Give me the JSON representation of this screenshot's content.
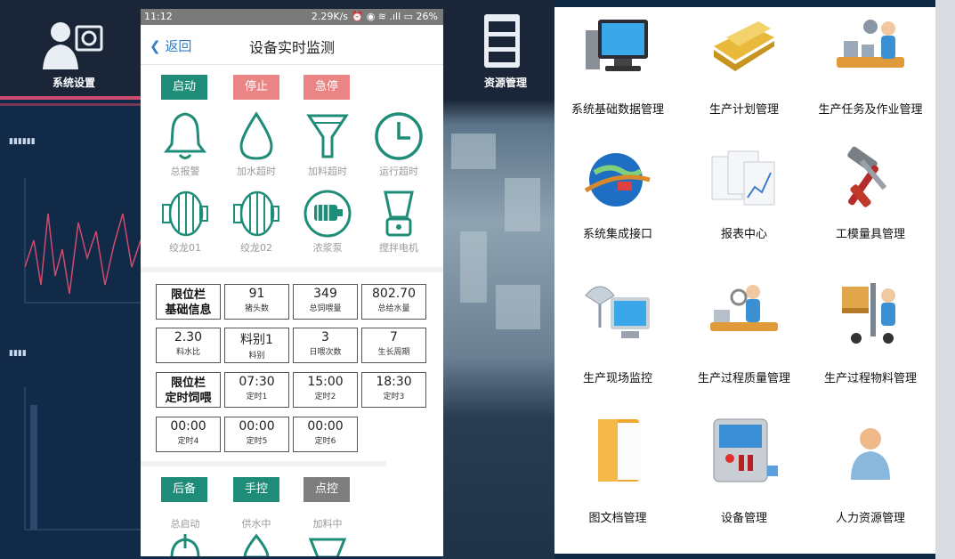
{
  "dashboard": {
    "sys_label": "系统设置",
    "res_label": "资源管理",
    "icons": [
      "user-settings-icon",
      "cabinet-icon"
    ]
  },
  "phone": {
    "status": {
      "time": "11:12",
      "right": "2.29K/s ⏰ ◉ ≋ .ıll ▭ 26%"
    },
    "nav": {
      "back": "返回",
      "title": "设备实时监测"
    },
    "top_buttons": [
      {
        "label": "启动",
        "color": "#1f8c77"
      },
      {
        "label": "停止",
        "color": "#ea8585"
      },
      {
        "label": "急停",
        "color": "#ea8585"
      }
    ],
    "devices_row1": [
      {
        "label": "总报警",
        "icon": "bell-icon"
      },
      {
        "label": "加水超时",
        "icon": "water-drop-icon"
      },
      {
        "label": "加料超时",
        "icon": "funnel-icon"
      },
      {
        "label": "运行超时",
        "icon": "clock-icon"
      }
    ],
    "devices_row2": [
      {
        "label": "绞龙01",
        "icon": "auger-motor-icon"
      },
      {
        "label": "绞龙02",
        "icon": "auger-motor-icon"
      },
      {
        "label": "浓浆泵",
        "icon": "pump-icon"
      },
      {
        "label": "搅拌电机",
        "icon": "blender-icon"
      }
    ],
    "grid": {
      "row1": {
        "header": [
          "限位栏",
          "基础信息"
        ],
        "cells": [
          {
            "value": "91",
            "unit": "猪头数"
          },
          {
            "value": "349",
            "unit": "总饲喂量"
          },
          {
            "value": "802.70",
            "unit": "总给水量"
          }
        ]
      },
      "row2": {
        "cells": [
          {
            "value": "2.30",
            "unit": "料水比"
          },
          {
            "value": "料别1",
            "unit": "料别"
          },
          {
            "value": "3",
            "unit": "日喂次数"
          },
          {
            "value": "7",
            "unit": "生长周期"
          }
        ]
      },
      "row3": {
        "header": [
          "限位栏",
          "定时饲喂"
        ],
        "cells": [
          {
            "value": "07:30",
            "unit": "定时1"
          },
          {
            "value": "15:00",
            "unit": "定时2"
          },
          {
            "value": "18:30",
            "unit": "定时3"
          }
        ]
      },
      "row4": {
        "cells": [
          {
            "value": "00:00",
            "unit": "定时4"
          },
          {
            "value": "00:00",
            "unit": "定时5"
          },
          {
            "value": "00:00",
            "unit": "定时6"
          }
        ]
      }
    },
    "bottom_buttons": [
      {
        "label": "后备",
        "color": "#1f8c77"
      },
      {
        "label": "手控",
        "color": "#1f8c77"
      },
      {
        "label": "点控",
        "color": "#7e7e7e"
      }
    ],
    "bottom_status": [
      "总启动",
      "供水中",
      "加料中"
    ]
  },
  "menu": {
    "items": [
      {
        "label": "系统基础数据管理",
        "icon": "monitor-icon"
      },
      {
        "label": "生产计划管理",
        "icon": "folder-icon"
      },
      {
        "label": "生产任务及作业管理",
        "icon": "worker-conveyor-icon"
      },
      {
        "label": "系统集成接口",
        "icon": "globe-plug-icon"
      },
      {
        "label": "报表中心",
        "icon": "report-charts-icon"
      },
      {
        "label": "工模量具管理",
        "icon": "hammer-screwdriver-icon"
      },
      {
        "label": "生产现场监控",
        "icon": "satellite-monitor-icon"
      },
      {
        "label": "生产过程质量管理",
        "icon": "quality-inspection-icon"
      },
      {
        "label": "生产过程物料管理",
        "icon": "forklift-icon"
      },
      {
        "label": "图文档管理",
        "icon": "document-folder-icon"
      },
      {
        "label": "设备管理",
        "icon": "control-panel-icon"
      },
      {
        "label": "人力资源管理",
        "icon": "person-icon"
      }
    ]
  }
}
